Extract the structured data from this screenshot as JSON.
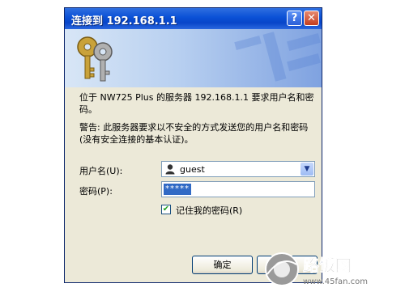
{
  "dialog": {
    "title": "连接到 192.168.1.1",
    "help_label": "?",
    "close_label": "✕",
    "message": "位于 NW725 Plus 的服务器 192.168.1.1 要求用户名和密码。",
    "warning": "警告: 此服务器要求以不安全的方式发送您的用户名和密码(没有安全连接的基本认证)。",
    "username_label": "用户名(U):",
    "username_value": "guest",
    "password_label": "密码(P):",
    "password_mask": "*****",
    "remember_label": "记住我的密码(R)",
    "remember_checked": true,
    "ok_label": "确定",
    "cancel_label": ""
  },
  "watermark": {
    "brand": "路饭网",
    "url": "www.45fan.com"
  },
  "colors": {
    "title_bar": "#0a50d6",
    "dialog_bg": "#ece9d8",
    "selection": "#316ac5"
  }
}
